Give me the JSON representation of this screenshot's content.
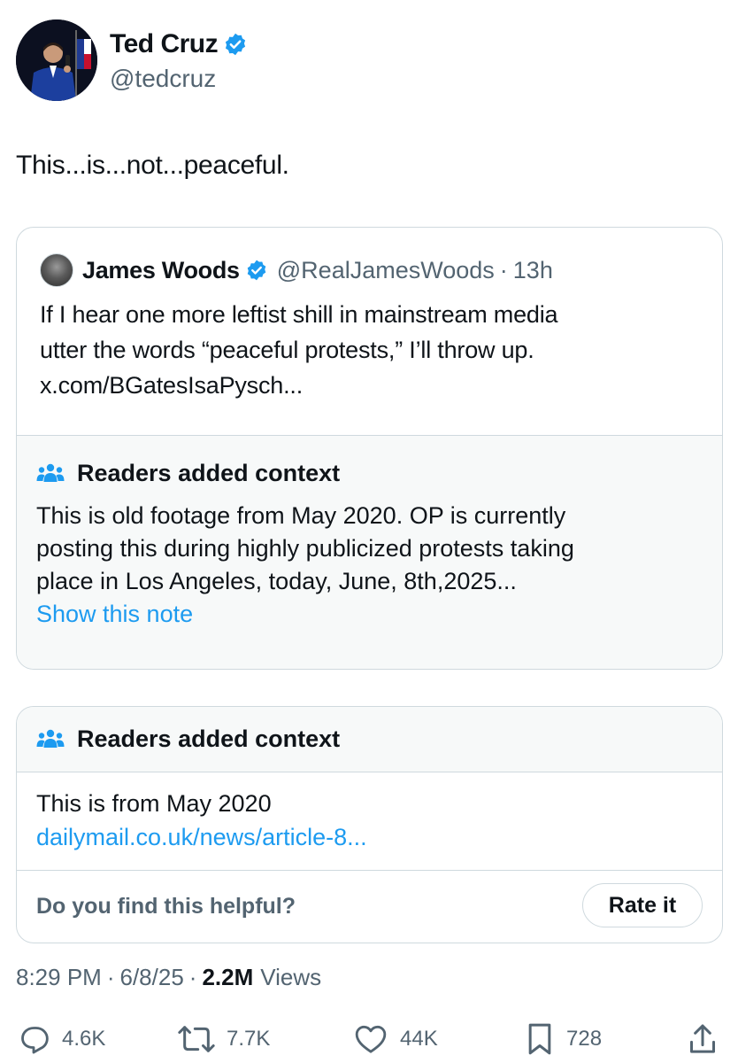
{
  "author": {
    "name": "Ted Cruz",
    "handle": "@tedcruz",
    "verified_color": "#1d9bf0"
  },
  "tweet": {
    "text": "This...is...not...peaceful."
  },
  "quoted": {
    "name": "James Woods",
    "handle": "@RealJamesWoods",
    "dot": "·",
    "time": "13h",
    "lines": [
      "If I hear one more leftist shill in mainstream media",
      "utter the words “peaceful protests,” I’ll throw up.",
      "x.com/BGatesIsaPysch..."
    ],
    "note": {
      "title": "Readers added context",
      "lines": [
        "This is old footage from May 2020. OP is currently",
        "posting this during highly publicized protests taking",
        "place in Los Angeles, today, June, 8th,2025..."
      ],
      "show_label": "Show this note"
    }
  },
  "community_note": {
    "title": "Readers added context",
    "text": "This is from May 2020",
    "link": "dailymail.co.uk/news/article-8...",
    "helpful_question": "Do you find this helpful?",
    "rate_label": "Rate it"
  },
  "meta": {
    "time": "8:29 PM",
    "sep": "·",
    "date": "6/8/25",
    "views_count": "2.2M",
    "views_label": "Views"
  },
  "actions": {
    "replies": "4.6K",
    "reposts": "7.7K",
    "likes": "44K",
    "bookmarks": "728"
  },
  "colors": {
    "accent": "#1d9bf0",
    "secondary_text": "#536471",
    "border": "#cfd9de",
    "note_bg": "#f7f9f9"
  }
}
